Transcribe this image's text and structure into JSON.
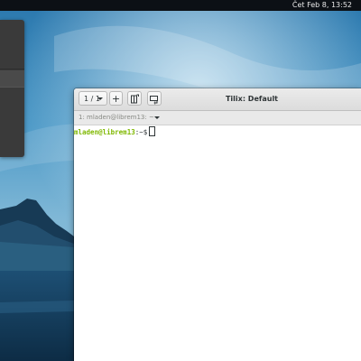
{
  "topbar": {
    "clock": "Čet Feb  8, 13:52"
  },
  "tilix": {
    "title": "Tilix: Default",
    "session_label": "1 / 1",
    "add_label": "+",
    "terminal_title": "1: mladen@librem13: ~",
    "prompt": {
      "user_host": "mladen@librem13",
      "separator": ":",
      "path": "~$"
    }
  },
  "colors": {
    "prompt_user": "#7fb800",
    "headerbar": "#e4e4e4",
    "terminal_bg": "#ffffff",
    "topbar_bg": "#0c1015"
  },
  "icons": {
    "session_dropdown": "chevron-down-icon",
    "split_right": "split-right-icon",
    "split_down": "split-down-icon",
    "terminal_menu": "chevron-down-icon"
  }
}
